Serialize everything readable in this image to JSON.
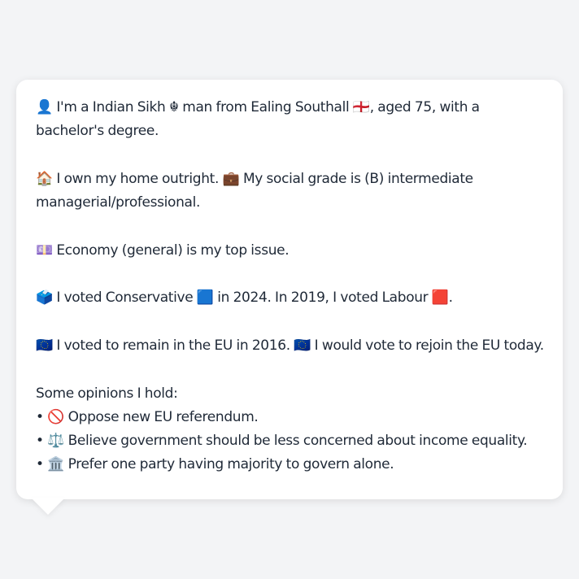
{
  "profile": {
    "intro": {
      "text_1": "👤 I'm a Indian Sikh ☬ man from Ealing Southall 🏴󠁧󠁢󠁥󠁮󠁧󠁿, aged 75, with a",
      "text_2": "bachelor's degree."
    },
    "home": {
      "text_1": "🏠 I own my home outright. 💼 My social grade is (B) intermediate",
      "text_2": "managerial/professional."
    },
    "issue": {
      "text": "💷 Economy (general) is my top issue."
    },
    "vote": {
      "text": "🗳️ I voted Conservative 🟦 in 2024. In 2019, I voted Labour 🟥."
    },
    "eu": {
      "text": "🇪🇺 I voted to remain in the EU in 2016. 🇪🇺 I would vote to rejoin the EU today."
    },
    "opinions": {
      "heading": "Some opinions I hold:",
      "items": [
        "• 🚫 Oppose new EU referendum.",
        "• ⚖️ Believe government should be less concerned about income equality.",
        "• 🏛️ Prefer one party having majority to govern alone."
      ]
    }
  }
}
